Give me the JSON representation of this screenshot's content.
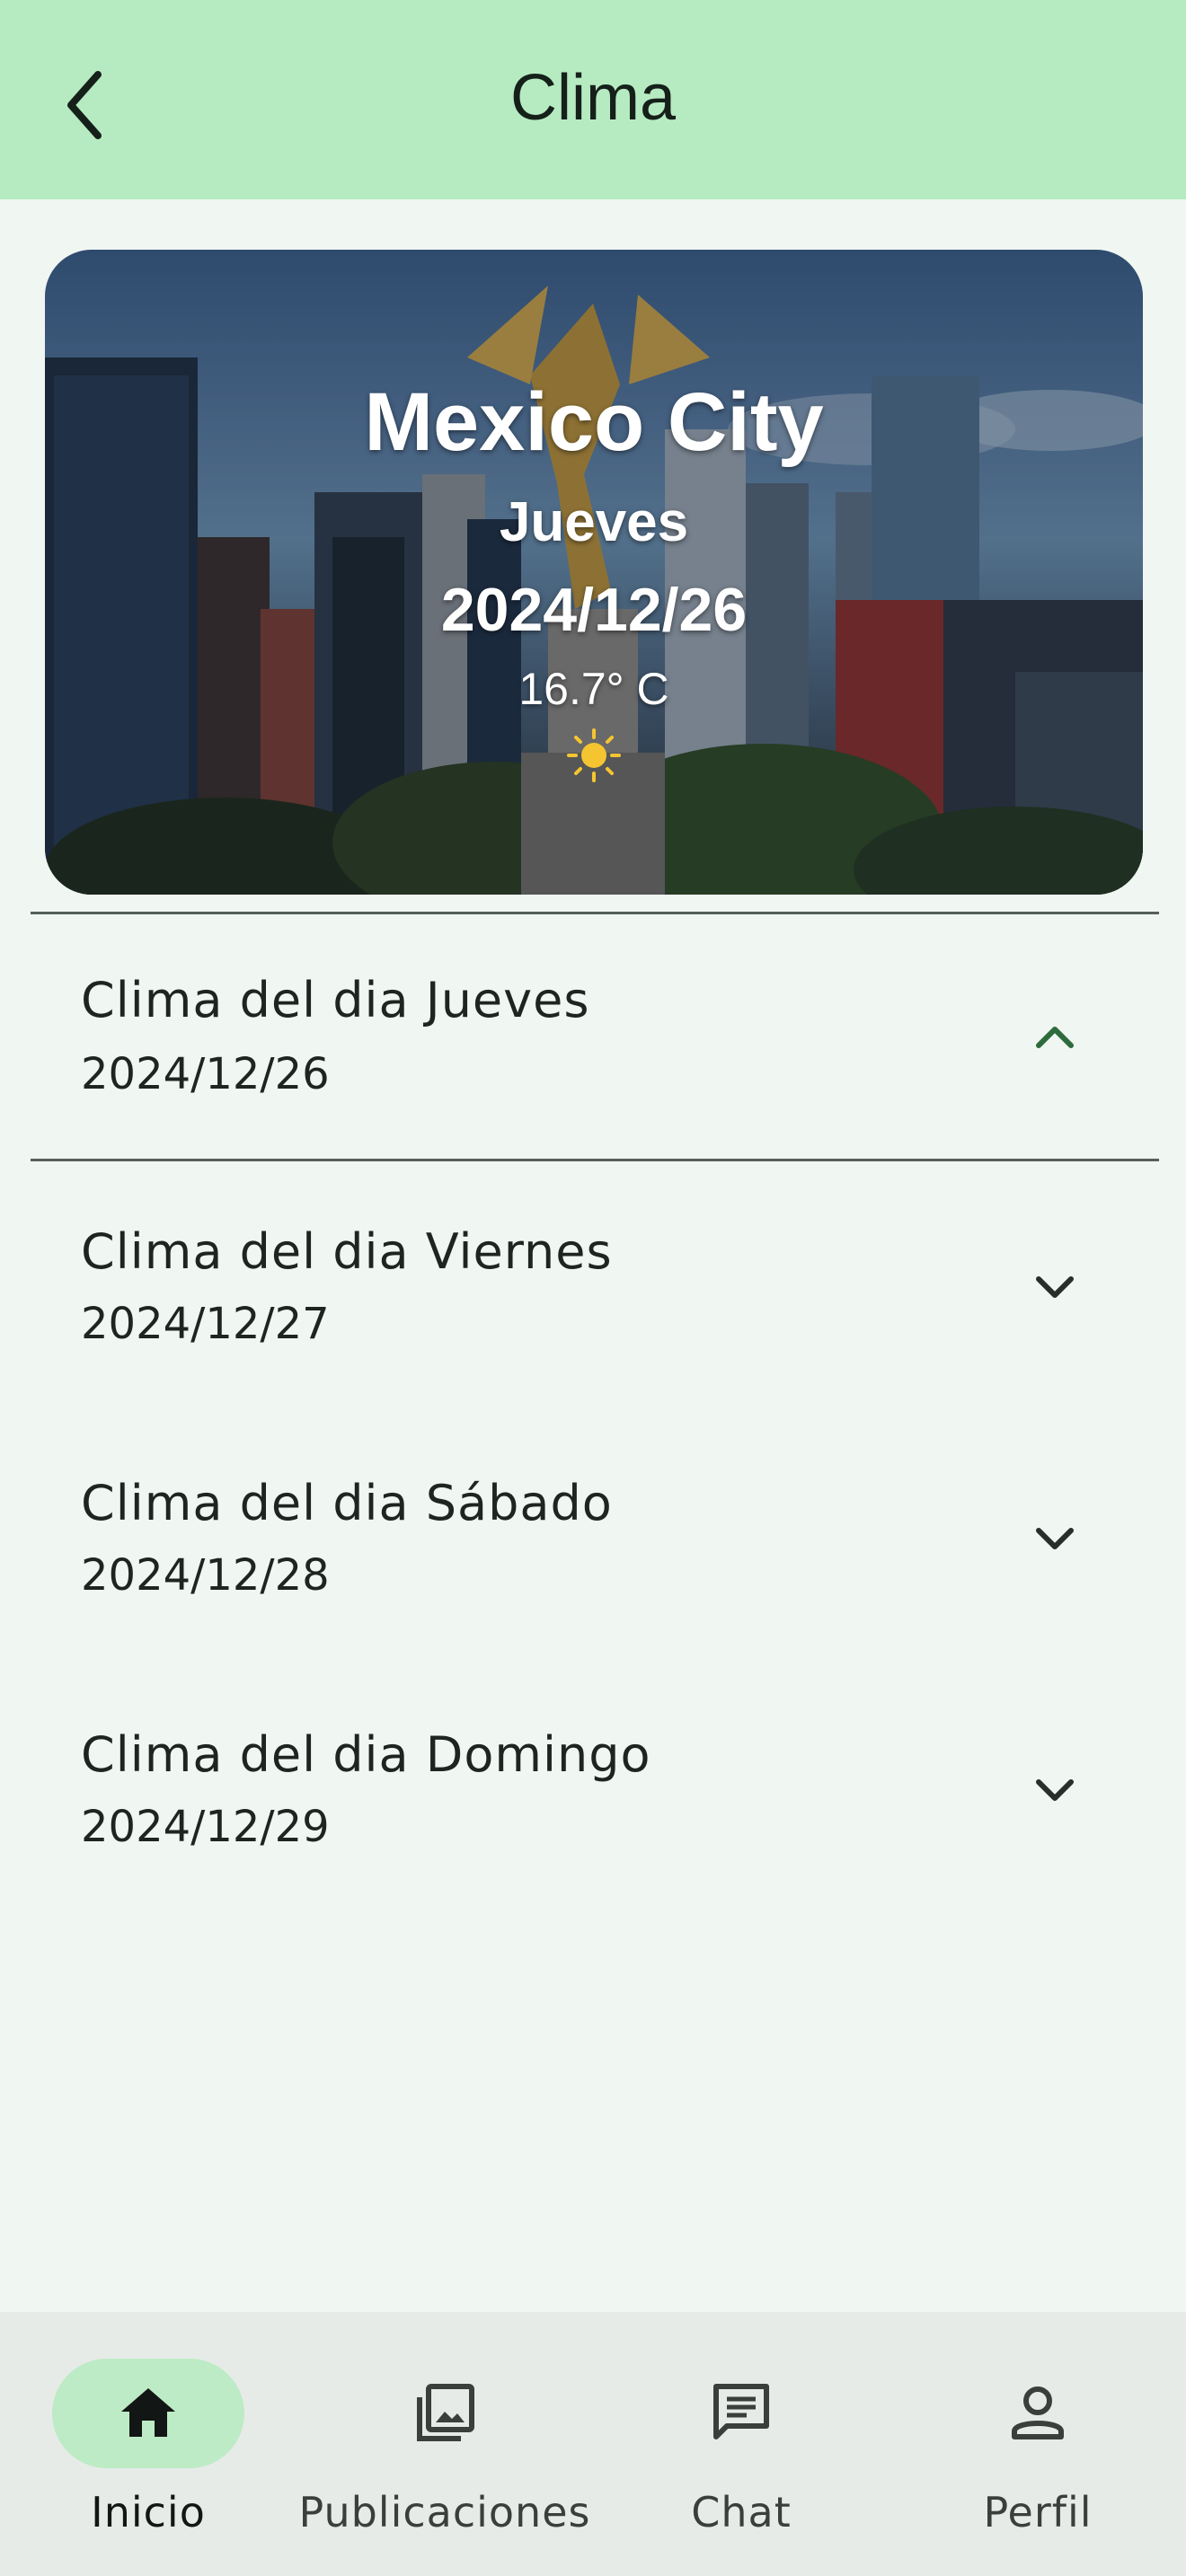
{
  "appbar": {
    "title": "Clima",
    "back_icon": "arrow-back-icon"
  },
  "hero": {
    "city": "Mexico City",
    "day": "Jueves",
    "date": "2024/12/26",
    "temperature": "16.7° C",
    "condition_icon": "sun-icon"
  },
  "forecast": [
    {
      "title": "Clima del dia Jueves",
      "date": "2024/12/26",
      "expanded": true,
      "icon": "chevron-up-icon"
    },
    {
      "title": "Clima del dia Viernes",
      "date": "2024/12/27",
      "expanded": false,
      "icon": "chevron-down-icon"
    },
    {
      "title": "Clima del dia Sábado",
      "date": "2024/12/28",
      "expanded": false,
      "icon": "chevron-down-icon"
    },
    {
      "title": "Clima del dia Domingo",
      "date": "2024/12/29",
      "expanded": false,
      "icon": "chevron-down-icon"
    }
  ],
  "bottom_nav": {
    "items": [
      {
        "label": "Inicio",
        "icon": "home-icon",
        "active": true
      },
      {
        "label": "Publicaciones",
        "icon": "photo-library-icon",
        "active": false
      },
      {
        "label": "Chat",
        "icon": "chat-icon",
        "active": false
      },
      {
        "label": "Perfil",
        "icon": "person-icon",
        "active": false
      }
    ]
  },
  "colors": {
    "appbar_bg": "#b6ebc1",
    "page_bg": "#f0f6f2",
    "active_pill": "#bdebc5",
    "accent_chevron": "#2e6b3c",
    "sun": "#f5c531"
  }
}
